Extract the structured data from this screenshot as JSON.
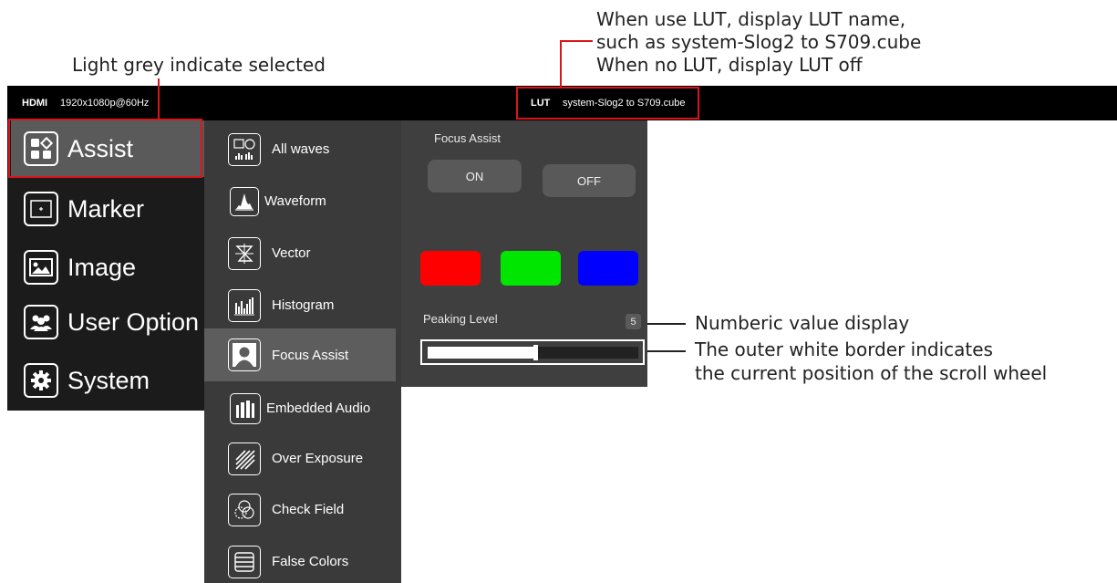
{
  "annotations": {
    "selected_note": "Light grey indicate selected",
    "lut_note_line1": "When use LUT, display LUT name,",
    "lut_note_line2": "such as system-Slog2 to S709.cube",
    "lut_note_line3": "When no LUT, display LUT off",
    "value_note": "Numberic value display",
    "border_note_line1": "The outer white border indicates",
    "border_note_line2": "the current position of the scroll wheel"
  },
  "topbar": {
    "input_label": "HDMI",
    "resolution": "1920x1080p@60Hz",
    "lut_label": "LUT",
    "lut_name": "system-Slog2 to S709.cube"
  },
  "main_menu": {
    "selected": "Assist",
    "items": [
      {
        "label": "Assist",
        "icon": "assist-icon"
      },
      {
        "label": "Marker",
        "icon": "marker-icon"
      },
      {
        "label": "Image",
        "icon": "image-icon"
      },
      {
        "label": "User Option",
        "icon": "user-option-icon"
      },
      {
        "label": "System",
        "icon": "gear-icon"
      }
    ]
  },
  "sub_menu": {
    "selected": "Focus Assist",
    "items": [
      {
        "label": "All waves",
        "icon": "all-waves-icon"
      },
      {
        "label": "Waveform",
        "icon": "waveform-icon"
      },
      {
        "label": "Vector",
        "icon": "vector-icon"
      },
      {
        "label": "Histogram",
        "icon": "histogram-icon"
      },
      {
        "label": "Focus Assist",
        "icon": "focus-assist-icon"
      },
      {
        "label": "Embedded Audio",
        "icon": "audio-icon"
      },
      {
        "label": "Over Exposure",
        "icon": "over-exposure-icon"
      },
      {
        "label": "Check Field",
        "icon": "check-field-icon"
      },
      {
        "label": "False Colors",
        "icon": "false-colors-icon"
      }
    ]
  },
  "panel": {
    "title": "Focus Assist",
    "on_label": "ON",
    "off_label": "OFF",
    "colors": [
      "#ff0000",
      "#00e600",
      "#0000ff"
    ],
    "peaking_label": "Peaking Level",
    "peaking_value": "5",
    "peaking_fraction": 0.5
  },
  "accent_color": "#d9151b"
}
